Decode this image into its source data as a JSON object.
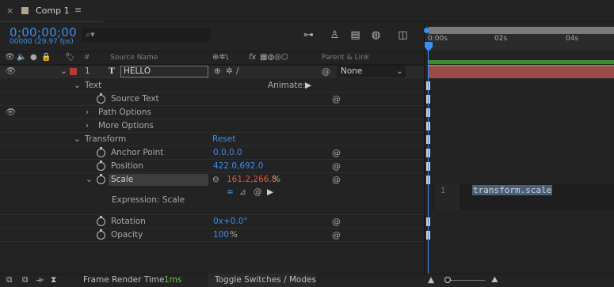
{
  "tab": {
    "close": "×",
    "title": "Comp 1",
    "menu": "≡"
  },
  "time": {
    "timecode": "0;00;00;00",
    "frames": "00000 (29.97 fps)"
  },
  "search": {
    "icon": "search-icon",
    "value": ""
  },
  "headers": {
    "num": "#",
    "source_name": "Source Name",
    "parent_link": "Parent & Link",
    "fx": "fx"
  },
  "ruler": {
    "ticks": [
      "0:00s",
      "02s",
      "04s"
    ]
  },
  "layer": {
    "number": "1",
    "type_icon": "T",
    "name": "HELLO",
    "parent": "None",
    "swatch_color": "#b13d35"
  },
  "properties": {
    "text": "Text",
    "animate": "Animate:",
    "source_text": "Source Text",
    "path_options": "Path Options",
    "more_options": "More Options",
    "transform": "Transform",
    "reset": "Reset",
    "anchor_point": {
      "label": "Anchor Point",
      "value": "0.0,0.0"
    },
    "position": {
      "label": "Position",
      "value": "422.0,692.0"
    },
    "scale": {
      "label": "Scale",
      "value": "161.2,266.8",
      "unit": "%"
    },
    "expression_label": "Expression: Scale",
    "rotation": {
      "label": "Rotation",
      "value": "0x+0.0°"
    },
    "opacity": {
      "label": "Opacity",
      "value": "100",
      "unit": "%"
    }
  },
  "expression": {
    "line": "1",
    "code": "transform.scale"
  },
  "footer": {
    "render_label": "Frame Render Time",
    "render_value": "1ms",
    "toggle": "Toggle Switches / Modes"
  },
  "colors": {
    "accent": "#3a8ef0",
    "scale_value": "#e05a3a",
    "layer_bar": "#9b4a4a"
  }
}
